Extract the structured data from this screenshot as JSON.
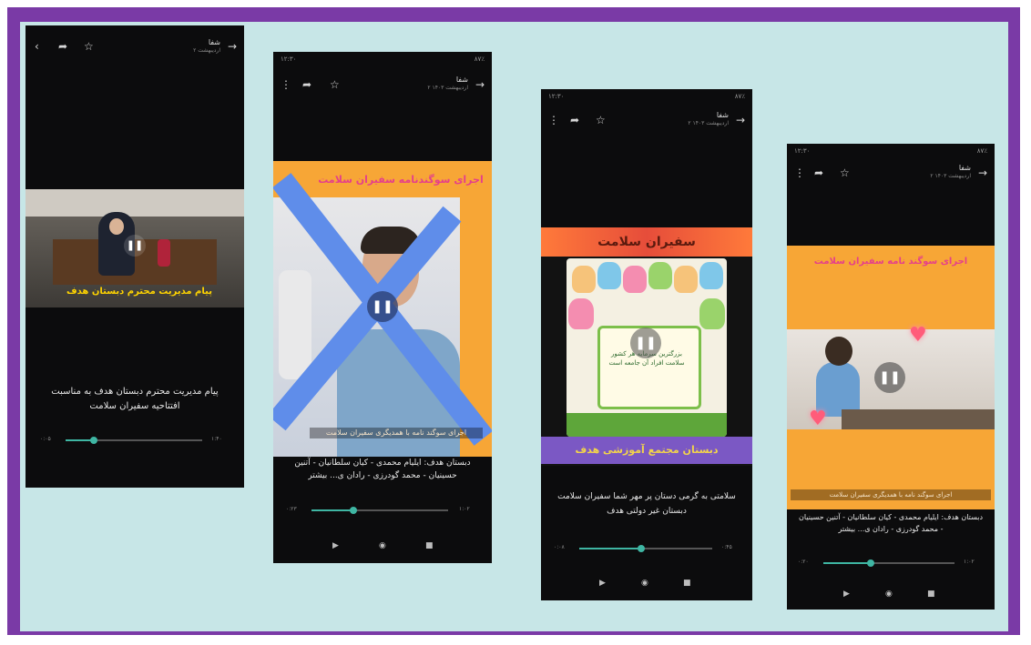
{
  "colors": {
    "frame": "#7a3aa6",
    "background": "#c7e6e7",
    "accent": "#3fb6a3",
    "orange": "#f7a636",
    "pink": "#e53f8b"
  },
  "phone1": {
    "title": "شفا",
    "subtitle": "۲ اردیبهشت",
    "video_overlay": "پیام مدیریت محترم دبستان هدف",
    "caption": "پیام مدیریت محترم دبستان هدف به مناسبت افتتاحیه سفیران سلامت",
    "time_current": "۰:۰۵",
    "time_total": "۱:۴۰",
    "progress": 0.2,
    "icons": [
      "back-icon",
      "share-icon",
      "star-icon",
      "arrow-icon"
    ]
  },
  "phone2": {
    "status_left": "۱۲:۳۰",
    "status_right": "۸۷٪",
    "title": "شفا",
    "subtitle": "۲ اردیبهشت ۱۴۰۳",
    "banner": "اجرای سوگندنامه سفیران سلامت",
    "caption_overlay": "اجرای سوگند نامه با همدیگری سفیران سلامت",
    "caption": "دبستان هدف: ایلیام محمدی - کیان سلطانیان - آتنین حسینیان - محمد گودرزی - رادان ی... بیشتر",
    "time_current": "۰:۲۳",
    "time_total": "۱:۰۲",
    "progress": 0.3
  },
  "phone3": {
    "status_left": "۱۲:۳۰",
    "status_right": "۸۷٪",
    "title": "شفا",
    "subtitle": "۲ اردیبهشت ۱۴۰۳",
    "banner_top": "سفیران سلامت",
    "banner_bottom": "دبستان مجتمع آموزشی هدف",
    "card_text": "بزرگترین سرمایه هر کشور سلامت افراد آن جامعه است",
    "caption": "سلامتی به گرمی دستان پر مهر شما سفیران سلامت دبستان غیر دولتی هدف",
    "time_current": "۰:۰۸",
    "time_total": "۰:۴۵",
    "progress": 0.45
  },
  "phone4": {
    "status_left": "۱۲:۳۰",
    "status_right": "۸۷٪",
    "title": "شفا",
    "subtitle": "۲ اردیبهشت ۱۴۰۳",
    "banner": "اجرای سوگند نامه سفیران سلامت",
    "caption_overlay": "اجرای سوگند نامه با همدیگری سفیران سلامت",
    "caption": "دبستان هدف: ایلیام محمدی - کیان سلطانیان - آتنین حسینیان - محمد گودرزی - رادان ی... بیشتر",
    "time_current": "۰:۲۰",
    "time_total": "۱:۰۲",
    "progress": 0.35
  }
}
